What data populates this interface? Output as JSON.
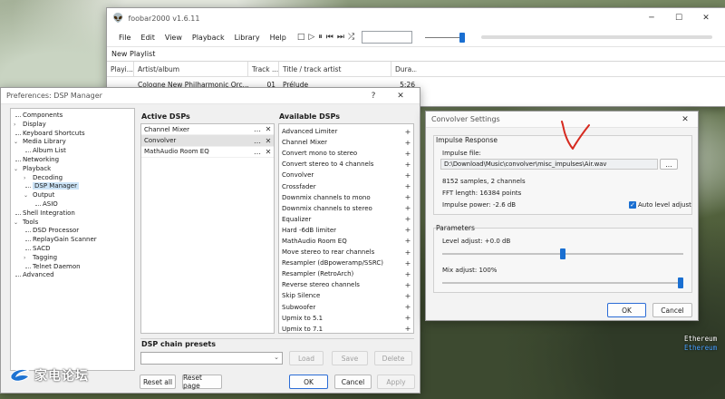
{
  "foobar": {
    "title": "foobar2000 v1.6.11",
    "menu": [
      "File",
      "Edit",
      "View",
      "Playback",
      "Library",
      "Help"
    ],
    "toolbar_icons": [
      "stop-icon",
      "play-icon",
      "pause-icon",
      "previous-icon",
      "next-icon",
      "random-icon"
    ],
    "volume_level": 1.0,
    "tab": "New Playlist",
    "columns": [
      "Playi...",
      "Artist/album",
      "Track ...",
      "Title / track artist",
      "Dura..."
    ],
    "rows": [
      {
        "playing": "",
        "artist_album": "Cologne New Philharmonic Orc...",
        "track": "01",
        "title": "Prélude",
        "duration": "5:26"
      }
    ]
  },
  "prefs": {
    "title": "Preferences: DSP Manager",
    "title_buttons": [
      "?",
      "✕"
    ],
    "tree": [
      {
        "label": "Components",
        "level": 0,
        "expand": ""
      },
      {
        "label": "Display",
        "level": 0,
        "expand": "collapsed"
      },
      {
        "label": "Keyboard Shortcuts",
        "level": 0,
        "expand": ""
      },
      {
        "label": "Media Library",
        "level": 0,
        "expand": "expanded"
      },
      {
        "label": "Album List",
        "level": 1,
        "expand": ""
      },
      {
        "label": "Networking",
        "level": 0,
        "expand": ""
      },
      {
        "label": "Playback",
        "level": 0,
        "expand": "expanded"
      },
      {
        "label": "Decoding",
        "level": 1,
        "expand": "collapsed"
      },
      {
        "label": "DSP Manager",
        "level": 1,
        "expand": "",
        "selected": true
      },
      {
        "label": "Output",
        "level": 1,
        "expand": "expanded"
      },
      {
        "label": "ASIO",
        "level": 2,
        "expand": ""
      },
      {
        "label": "Shell Integration",
        "level": 0,
        "expand": ""
      },
      {
        "label": "Tools",
        "level": 0,
        "expand": "expanded"
      },
      {
        "label": "DSD Processor",
        "level": 1,
        "expand": ""
      },
      {
        "label": "ReplayGain Scanner",
        "level": 1,
        "expand": ""
      },
      {
        "label": "SACD",
        "level": 1,
        "expand": ""
      },
      {
        "label": "Tagging",
        "level": 1,
        "expand": "collapsed"
      },
      {
        "label": "Telnet Daemon",
        "level": 1,
        "expand": ""
      },
      {
        "label": "Advanced",
        "level": 0,
        "expand": ""
      }
    ],
    "active_title": "Active DSPs",
    "active": [
      {
        "label": "Channel Mixer",
        "selected": false
      },
      {
        "label": "Convolver",
        "selected": true
      },
      {
        "label": "MathAudio Room EQ",
        "selected": false
      }
    ],
    "available_title": "Available DSPs",
    "available": [
      "Advanced Limiter",
      "Channel Mixer",
      "Convert mono to stereo",
      "Convert stereo to 4 channels",
      "Convolver",
      "Crossfader",
      "Downmix channels to mono",
      "Downmix channels to stereo",
      "Equalizer",
      "Hard -6dB limiter",
      "MathAudio Room EQ",
      "Move stereo to rear channels",
      "Resampler (dBpoweramp/SSRC)",
      "Resampler (RetroArch)",
      "Reverse stereo channels",
      "Skip Silence",
      "Subwoofer",
      "Upmix to 5.1",
      "Upmix to 7.1"
    ],
    "presets_title": "DSP chain presets",
    "presets_combo": "",
    "load": "Load",
    "save": "Save",
    "delete": "Delete",
    "reset_all": "Reset all",
    "reset_page": "Reset page",
    "ok": "OK",
    "cancel": "Cancel",
    "apply": "Apply"
  },
  "convolver": {
    "title": "Convolver Settings",
    "close": "✕",
    "impulse_group": "Impulse Response",
    "impulse_file_label": "Impulse file:",
    "impulse_path": "D:\\Download\\Music\\convolver\\misc_impulses\\Air.wav",
    "browse": "...",
    "samples": "8152 samples, 2 channels",
    "fft": "FFT length: 16384 points",
    "power": "Impulse power: -2.6 dB",
    "auto_level_label": "Auto level adjust",
    "auto_level_checked": true,
    "params_group": "Parameters",
    "level_label": "Level adjust: +0.0 dB",
    "level_value": 0.5,
    "mix_label": "Mix adjust: 100%",
    "mix_value": 1.0,
    "ok": "OK",
    "cancel": "Cancel"
  },
  "desktop": {
    "side_text": [
      "Ethereum",
      "Ethereum"
    ],
    "watermark": "家电论坛",
    "annotation_color": "#d62a1f"
  }
}
